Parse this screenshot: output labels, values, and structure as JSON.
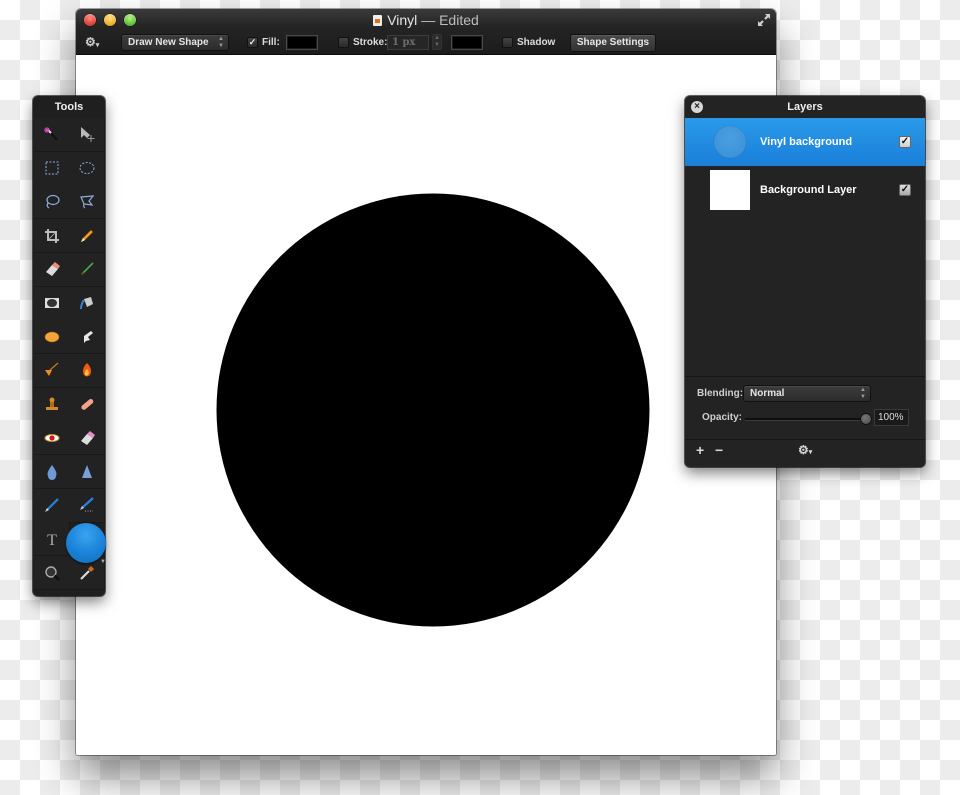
{
  "window": {
    "title": "Vinyl",
    "title_separator": "—",
    "title_status": "Edited"
  },
  "toolbar": {
    "gear_menu_icon": "gear-icon",
    "shape_mode": "Draw New Shape",
    "fill_checked": true,
    "fill_label": "Fill:",
    "fill_color": "#000000",
    "stroke_checked": false,
    "stroke_label": "Stroke:",
    "stroke_width": "1 px",
    "stroke_color": "#000000",
    "shadow_checked": false,
    "shadow_label": "Shadow",
    "shape_settings_label": "Shape Settings"
  },
  "canvas": {
    "background_color": "#ffffff",
    "shape": {
      "type": "circle",
      "fill": "#000000"
    }
  },
  "tools_panel": {
    "title": "Tools",
    "tools": [
      {
        "name": "magic-wand",
        "icon": "magic-wand-icon"
      },
      {
        "name": "move",
        "icon": "move-arrow-icon"
      },
      {
        "name": "rectangular-marquee",
        "icon": "rect-select-icon"
      },
      {
        "name": "elliptical-marquee",
        "icon": "ellipse-select-icon"
      },
      {
        "name": "lasso",
        "icon": "lasso-icon"
      },
      {
        "name": "polygonal-lasso",
        "icon": "polygon-lasso-icon"
      },
      {
        "name": "crop",
        "icon": "crop-icon"
      },
      {
        "name": "pencil",
        "icon": "pencil-icon"
      },
      {
        "name": "eraser",
        "icon": "eraser-icon"
      },
      {
        "name": "paint-brush",
        "icon": "brush-icon"
      },
      {
        "name": "vignette",
        "icon": "vignette-icon"
      },
      {
        "name": "paint-bucket",
        "icon": "paint-bucket-icon"
      },
      {
        "name": "sponge",
        "icon": "sponge-icon"
      },
      {
        "name": "smudge",
        "icon": "smudge-finger-icon"
      },
      {
        "name": "dodge",
        "icon": "dodge-icon"
      },
      {
        "name": "burn",
        "icon": "burn-flame-icon"
      },
      {
        "name": "clone-stamp",
        "icon": "stamp-icon"
      },
      {
        "name": "heal",
        "icon": "bandage-icon"
      },
      {
        "name": "red-eye",
        "icon": "red-eye-icon"
      },
      {
        "name": "background-eraser",
        "icon": "eraser-pink-icon"
      },
      {
        "name": "blur",
        "icon": "blur-drop-icon"
      },
      {
        "name": "sharpen",
        "icon": "sharpen-cone-icon"
      },
      {
        "name": "pen",
        "icon": "pen-icon"
      },
      {
        "name": "freeform-pen",
        "icon": "freeform-pen-icon"
      },
      {
        "name": "text",
        "icon": "text-icon",
        "glyph": "T"
      },
      {
        "name": "zoom",
        "icon": "magnifier-icon"
      },
      {
        "name": "eyedropper",
        "icon": "eyedropper-icon"
      }
    ],
    "color_well": "#1a82d8"
  },
  "layers_panel": {
    "title": "Layers",
    "layers": [
      {
        "name": "Vinyl background",
        "visible": true,
        "selected": true,
        "thumb": "circle"
      },
      {
        "name": "Background Layer",
        "visible": true,
        "selected": false,
        "thumb": "white"
      }
    ],
    "blending_label": "Blending:",
    "blending_value": "Normal",
    "opacity_label": "Opacity:",
    "opacity_value": "100%",
    "opacity": 1.0,
    "add_label": "+",
    "remove_label": "−"
  }
}
